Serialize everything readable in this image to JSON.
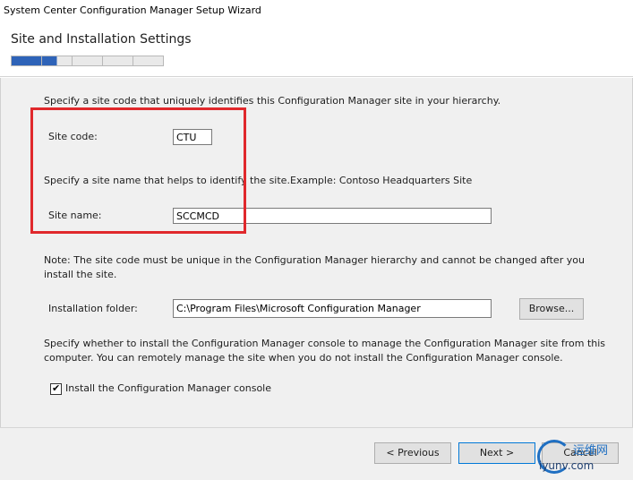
{
  "window": {
    "title": "System Center Configuration Manager Setup Wizard"
  },
  "header": {
    "page_title": "Site and Installation Settings",
    "progress": {
      "total_steps": 5,
      "completed_steps": 1.5,
      "fill_color": "#2e63b8"
    }
  },
  "site_code": {
    "instruction": "Specify a site code that uniquely identifies this Configuration Manager site in your hierarchy.",
    "label": "Site code:",
    "value": "CTU"
  },
  "site_name": {
    "instruction": "Specify a site name that helps to identify the site.",
    "example": "Example: Contoso Headquarters Site",
    "label": "Site name:",
    "value": "SCCMCD"
  },
  "note": "Note: The site code must be unique in the Configuration Manager hierarchy and cannot be changed after you install the site.",
  "install_folder": {
    "label": "Installation folder:",
    "value": "C:\\Program Files\\Microsoft Configuration Manager",
    "browse_label": "Browse..."
  },
  "console": {
    "instruction": "Specify whether to install the Configuration Manager console to manage the Configuration Manager site from this computer. You can remotely manage the site when you do not install the Configuration Manager console.",
    "checkbox_label": "Install the Configuration Manager console",
    "checked": true
  },
  "footer": {
    "previous_label": "< Previous",
    "next_label": "Next >",
    "cancel_label": "Cancel"
  },
  "watermark": {
    "line1": "运维网",
    "line2": "iyunv.com"
  },
  "colors": {
    "highlight_box": "#e0282c",
    "accent": "#0078d7"
  }
}
